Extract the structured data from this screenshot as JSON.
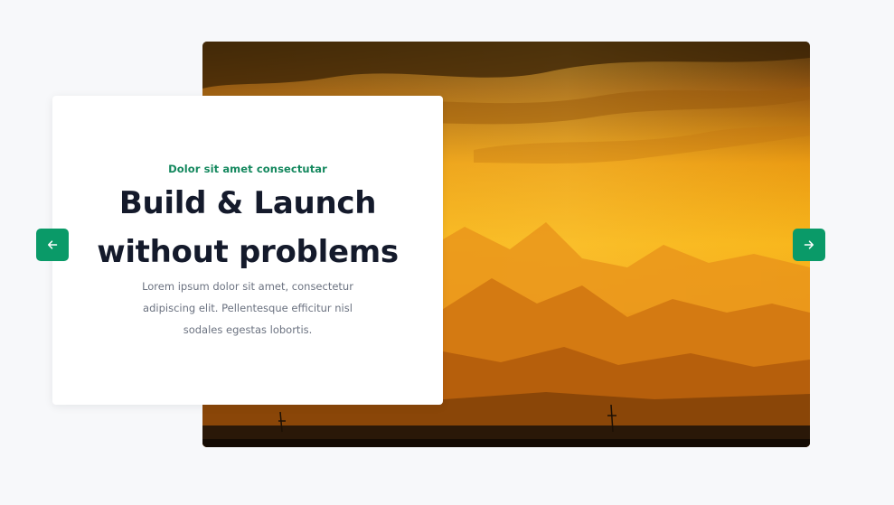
{
  "slide": {
    "eyebrow": "Dolor sit amet consectutar",
    "headline_line1": "Build & Launch",
    "headline_line2": "without problems",
    "body": "Lorem ipsum dolor sit amet, consectetur adipiscing elit. Pellentesque efficitur nisl sodales egestas lobortis."
  },
  "image": {
    "alt": "Golden sunset over layered mountain silhouettes"
  },
  "nav": {
    "prev_icon": "arrow-left-icon",
    "next_icon": "arrow-right-icon"
  },
  "colors": {
    "accent": "#0a9a68",
    "eyebrow": "#14885e",
    "headline": "#141a2b",
    "body": "#6b7280",
    "page_bg": "#f7f8fa"
  }
}
